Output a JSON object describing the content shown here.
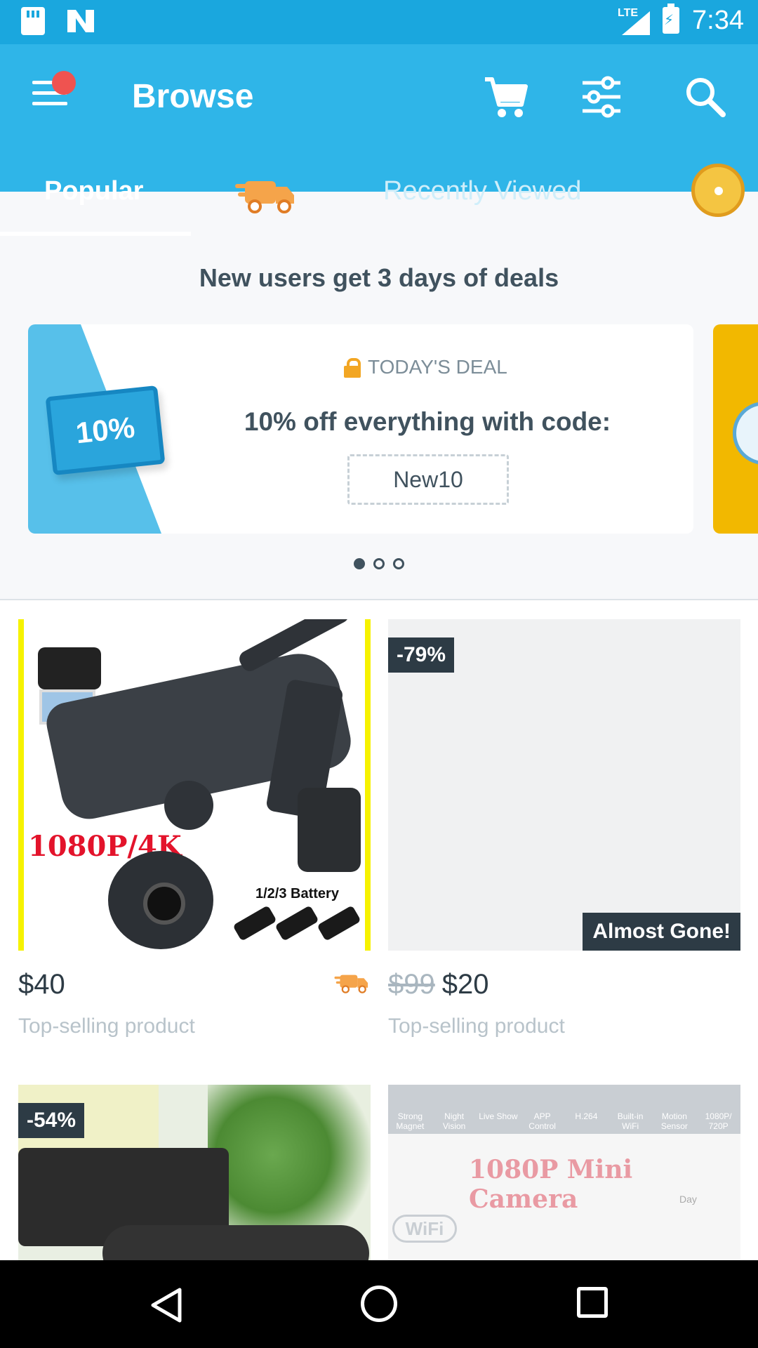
{
  "status_bar": {
    "time": "7:34",
    "network": "LTE"
  },
  "app_bar": {
    "title": "Browse"
  },
  "tabs": [
    {
      "label": "Popular",
      "selected": true
    },
    {
      "label": "Recently Viewed",
      "selected": false
    }
  ],
  "promo": {
    "heading": "New users get 3 days of deals",
    "ticket_text": "10%",
    "deal_label": "TODAY'S DEAL",
    "deal_text": "10% off everything with code:",
    "code": "New10",
    "carousel_pages": 3,
    "carousel_active": 1
  },
  "products": [
    {
      "price": "$40",
      "old_price": "",
      "subtitle": "Top-selling product",
      "image_text_main": "1080P/4K",
      "image_text_battery": "1/2/3 Battery",
      "badge": "",
      "tag": ""
    },
    {
      "price": "$20",
      "old_price": "$99",
      "subtitle": "Top-selling product",
      "badge": "-79%",
      "tag": "Almost Gone!"
    },
    {
      "badge": "-54%"
    },
    {
      "features": [
        "Strong Magnet",
        "Night Vision",
        "Live Show",
        "APP Control",
        "H.264",
        "Built-in WiFi",
        "Motion Sensor",
        "1080P/ 720P"
      ],
      "image_title": "1080P Mini Camera",
      "wifi_label": "WiFi",
      "day_label": "Day"
    }
  ],
  "colors": {
    "status_bar": "#1aa7de",
    "app_bar": "#2fb5e8",
    "accent_orange": "#f2a623",
    "badge_dark": "#2d3b45"
  }
}
